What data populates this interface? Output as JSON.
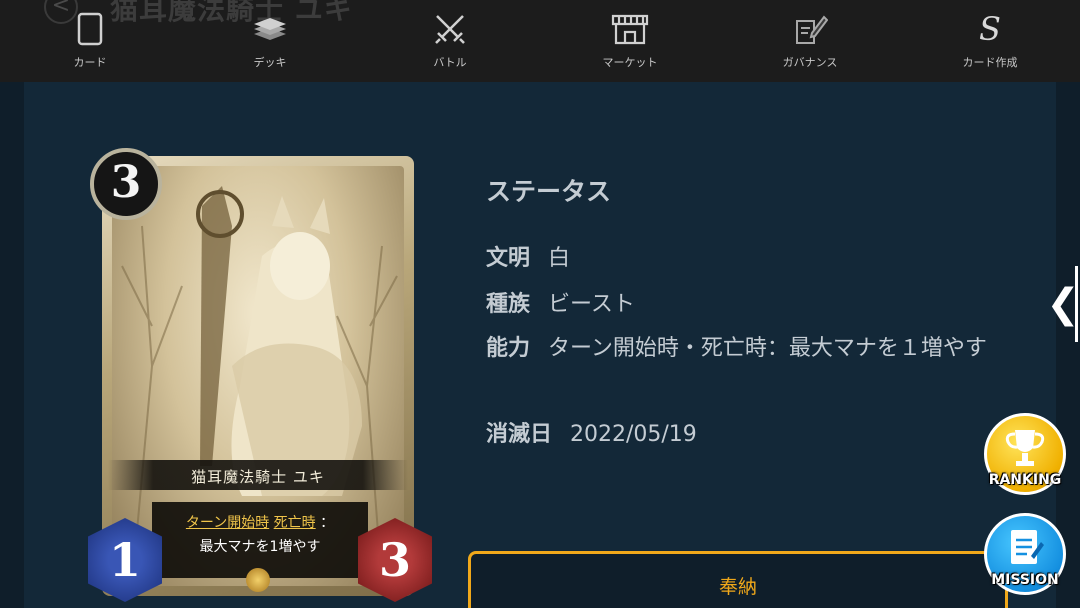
{
  "header": {
    "ghost_back": "<",
    "ghost_title": "猫耳魔法騎士 ユキ"
  },
  "nav": [
    {
      "label": "カード",
      "icon": "card-icon"
    },
    {
      "label": "デッキ",
      "icon": "deck-icon"
    },
    {
      "label": "バトル",
      "icon": "crossed-swords-icon"
    },
    {
      "label": "マーケット",
      "icon": "shop-icon"
    },
    {
      "label": "ガバナンス",
      "icon": "document-pen-icon"
    },
    {
      "label": "カード作成",
      "icon": "s-logo-icon",
      "glyph": "S"
    }
  ],
  "card": {
    "cost": "3",
    "name": "猫耳魔法騎士 ユキ",
    "text_keyword_1": "ターン開始時",
    "text_keyword_2": "死亡時",
    "text_colon": "：",
    "text_line2": "最大マナを1増やす",
    "attack": "1",
    "health": "3",
    "coin_icon": "coin-icon"
  },
  "status": {
    "title": "ステータス",
    "civ_label": "文明",
    "civ_value": "白",
    "tribe_label": "種族",
    "tribe_value": "ビースト",
    "ability_label": "能力",
    "ability_value": "ターン開始時・死亡時：最大マナを１増やす",
    "date_label": "消滅日",
    "date_value": "2022/05/19"
  },
  "actions": {
    "offer_label": "奉納"
  },
  "side": {
    "tab_glyph": "❮",
    "ranking_label": "RANKING",
    "mission_label": "MISSION"
  },
  "colors": {
    "accent": "#f0a81a",
    "panel": "#132838",
    "nav_bg": "#1c1c1c"
  }
}
